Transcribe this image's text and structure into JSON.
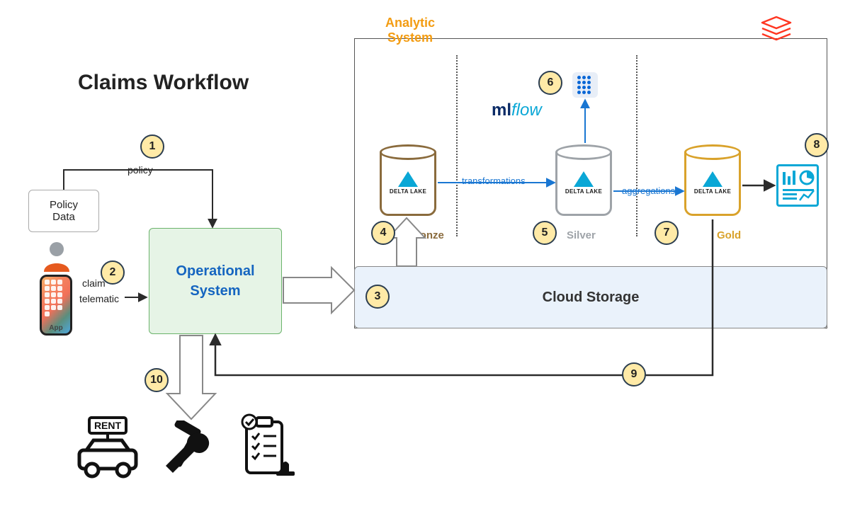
{
  "title": "Claims Workflow",
  "analytic_system_label": "Analytic\nSystem",
  "policy_data_box": "Policy\nData",
  "operational_system": "Operational\nSystem",
  "cloud_storage": "Cloud Storage",
  "inputs": {
    "policy_label": "policy",
    "claim_label": "claim",
    "telematic_label": "telematic"
  },
  "layers": {
    "bronze": "Bronze",
    "silver": "Silver",
    "gold": "Gold",
    "delta_lake": "DELTA LAKE"
  },
  "flows": {
    "transformations": "transformations",
    "aggregations": "aggregations"
  },
  "mlflow": {
    "ml": "ml",
    "flow": "flow"
  },
  "colors": {
    "bronze": "#8a6b3d",
    "silver": "#9ea3a8",
    "gold": "#d9a22b",
    "analytic_orange": "#F39C12",
    "databricks_red": "#FF3621",
    "flow_blue": "#1976d2",
    "op_green_bg": "#e6f4e6",
    "cloud_bg": "#eaf2fb",
    "badge_bg": "#ffeaa7"
  },
  "badges": {
    "1": "1",
    "2": "2",
    "3": "3",
    "4": "4",
    "5": "5",
    "6": "6",
    "7": "7",
    "8": "8",
    "9": "9",
    "10": "10"
  },
  "phone_label": "App",
  "icons": {
    "person": "person-icon",
    "phone": "phone-icon",
    "databricks": "databricks-logo-icon",
    "ai_brain": "ai-brain-icon",
    "chart": "analytics-chart-icon",
    "rent_car": "rent-car-icon",
    "tools": "tools-icon",
    "clipboard": "clipboard-verify-icon"
  },
  "outcomes": {
    "rent_label": "RENT"
  }
}
